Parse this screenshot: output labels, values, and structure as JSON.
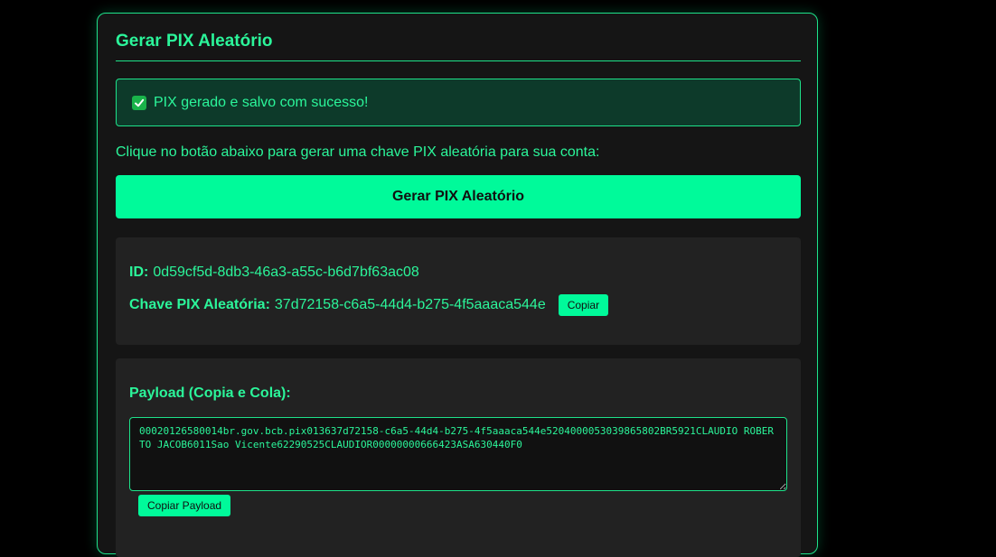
{
  "card": {
    "title": "Gerar PIX Aleatório"
  },
  "alert": {
    "icon": "check-icon",
    "message": "PIX gerado e salvo com sucesso!"
  },
  "instruction": "Clique no botão abaixo para gerar uma chave PIX aleatória para sua conta:",
  "generate_button": "Gerar PIX Aleatório",
  "info": {
    "id_label": "ID:",
    "id_value": "0d59cf5d-8db3-46a3-a55c-b6d7bf63ac08",
    "key_label": "Chave PIX Aleatória:",
    "key_value": "37d72158-c6a5-44d4-b275-4f5aaaca544e",
    "copy_label": "Copiar"
  },
  "payload": {
    "label": "Payload (Copia e Cola):",
    "value": "00020126580014br.gov.bcb.pix013637d72158-c6a5-44d4-b275-4f5aaaca544e5204000053039865802BR5921CLAUDIO ROBERTO JACOB6011Sao Vicente62290525CLAUDIOR00000000666423ASA630440F0",
    "copy_label": "Copiar Payload"
  },
  "colors": {
    "accent": "#00fa9a",
    "text": "#2bf59a",
    "background": "#000000",
    "card": "#151515",
    "panel": "#222222",
    "alert_bg": "#0d3a2a"
  }
}
